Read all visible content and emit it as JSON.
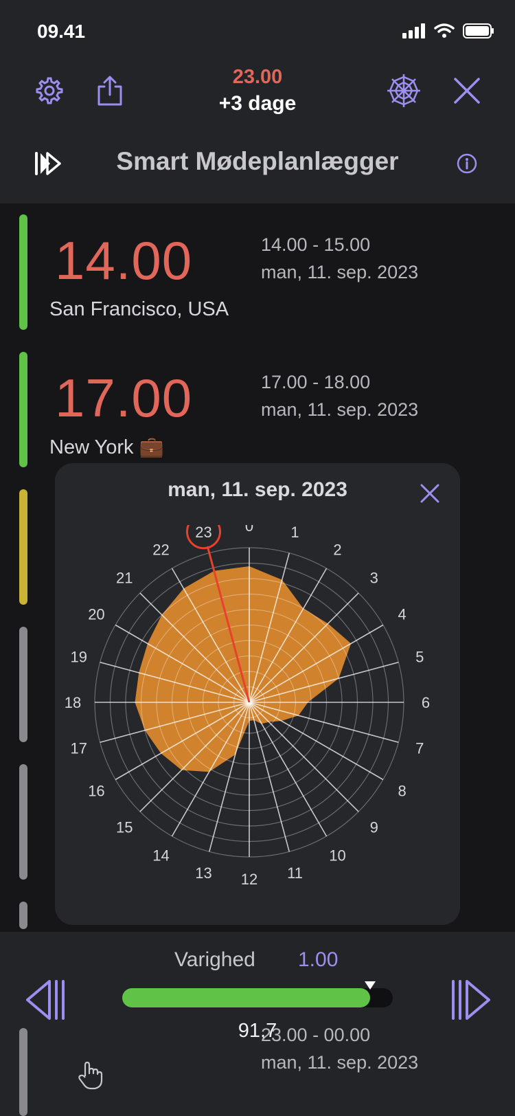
{
  "status": {
    "time": "09.41"
  },
  "header": {
    "time": "23.00",
    "days": "+3 dage",
    "title": "Smart Mødeplanlægger"
  },
  "rows": [
    {
      "time": "14.00",
      "range": "14.00 - 15.00",
      "date": "man, 11. sep. 2023",
      "city": "San Francisco, USA",
      "bar_color": "#61c248"
    },
    {
      "time": "17.00",
      "range": "17.00 - 18.00",
      "date": "man, 11. sep. 2023",
      "city": "New York 💼",
      "bar_color": "#61c248"
    }
  ],
  "last_row": {
    "range": "23.00 - 00.00",
    "date": "man, 11. sep. 2023"
  },
  "popup": {
    "title": "man, 11. sep. 2023",
    "selected_hour": 23,
    "hour_labels": [
      "0",
      "1",
      "2",
      "3",
      "4",
      "5",
      "6",
      "7",
      "8",
      "9",
      "10",
      "11",
      "12",
      "13",
      "14",
      "15",
      "16",
      "17",
      "18",
      "19",
      "20",
      "21",
      "22",
      "23"
    ],
    "radar_values": [
      0.88,
      0.82,
      0.7,
      0.72,
      0.76,
      0.6,
      0.38,
      0.33,
      0.24,
      0.18,
      0.16,
      0.12,
      0.12,
      0.35,
      0.52,
      0.62,
      0.66,
      0.7,
      0.74,
      0.74,
      0.76,
      0.8,
      0.85,
      0.88
    ]
  },
  "bottom": {
    "duration_label": "Varighed",
    "duration_value": "1.00",
    "percent": "91,7",
    "fill_fraction": 0.917
  },
  "colors": {
    "accent": "#9b8ff0",
    "time": "#e0675a",
    "radar_fill": "#e08a2c",
    "selection": "#e8412c",
    "green": "#61c248"
  },
  "icons": [
    "gear-icon",
    "share-icon",
    "spiderweb-icon",
    "close-icon",
    "fast-forward-icon",
    "info-icon",
    "rewind-icon",
    "hand-pointer-icon"
  ]
}
